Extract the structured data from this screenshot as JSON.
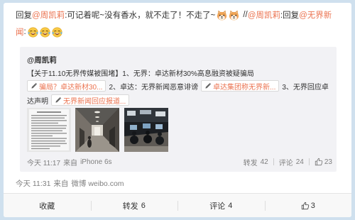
{
  "colors": {
    "frame": "#cfe0ee",
    "card": "#ffffff",
    "text": "#333333",
    "link": "#eb7350",
    "muted": "#808080",
    "retweet_bg": "#f2f2f5",
    "footer_bg": "#f8f8f8"
  },
  "post": {
    "line1": {
      "reply_prefix": "回复",
      "mention_a": "@周凯莉",
      "text_a": ":可记着呢~没有香水，就不走了！不走了~",
      "emoji_a": [
        "dog-emoji",
        "dog-emoji"
      ],
      "separator": "//",
      "mention_b": "@周凯莉",
      "text_b": ":回复",
      "mention_c_start": "@无界新"
    },
    "line2": {
      "mention_c_end": "闻",
      "text_c": ":",
      "emoji_b": [
        "laugh-cry-emoji",
        "laugh-cry-emoji",
        "laugh-cry-emoji"
      ]
    },
    "time": "今天 11:31",
    "source_prefix": "来自",
    "source": "微博 weibo.com"
  },
  "retweet": {
    "author": "@周凯莉",
    "line1": "【关于11.10无界传媒被围堵】1、无界：卓达新材30%高息融资被疑骗局",
    "link_icon": "pen-icon",
    "link_1": "骗局？卓达新材30...",
    "item_2": "2、卓达：无界新闻恶意诽谤",
    "link_2": "卓达集团称无界新...",
    "item_3_start": "3、无界回应卓",
    "item_3_end": "达声明",
    "link_3": "无界新闻回应报道...",
    "time": "今天 11:17",
    "source_prefix": "来自",
    "source": "iPhone 6s",
    "repost_label": "转发",
    "repost_count": "42",
    "comment_label": "评论",
    "comment_count": "24",
    "like_icon": "thumb-up-icon",
    "like_count": "23"
  },
  "actions": {
    "favorite": "收藏",
    "repost_label": "转发",
    "repost_count": "6",
    "comment_label": "评论",
    "comment_count": "4",
    "like_icon": "thumb-up-icon",
    "like_count": "3"
  }
}
